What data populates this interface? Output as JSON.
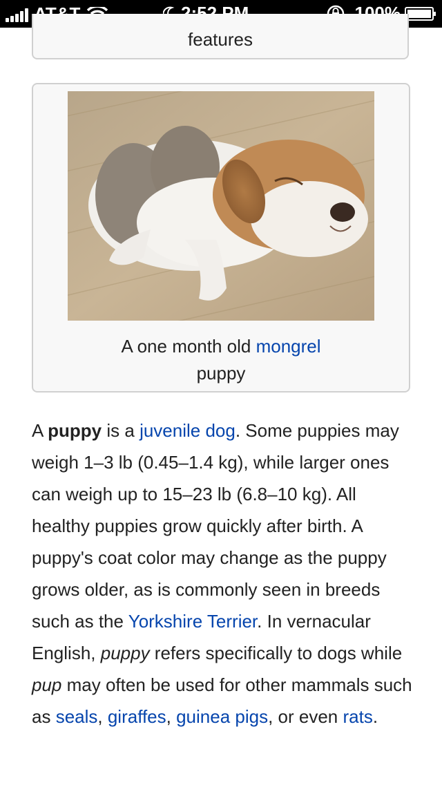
{
  "status_bar": {
    "carrier": "AT&T",
    "time": "2:52 PM",
    "battery": "100%",
    "icons": [
      "signal-icon",
      "wifi-icon",
      "moon-icon",
      "rotation-lock-icon",
      "battery-icon"
    ]
  },
  "top_card": {
    "caption": "features"
  },
  "figure": {
    "caption_prefix": "A one month old ",
    "caption_link": "mongrel",
    "caption_suffix": "puppy"
  },
  "article": {
    "t1": "A ",
    "bold_term": "puppy",
    "t2": " is a ",
    "link_juvenile_dog": "juvenile dog",
    "t3": ". Some puppies may weigh 1–3 lb (0.45–1.4 kg), while larger ones can weigh up to 15–23 lb (6.8–10 kg). All healthy puppies grow quickly after birth. A puppy's coat color may change as the puppy grows older, as is commonly seen in breeds such as the ",
    "link_yorkshire": "Yorkshire Terrier",
    "t4": ". In vernacular English, ",
    "italic_puppy": "puppy",
    "t5": " refers specifically to dogs while ",
    "italic_pup": "pup",
    "t6": " may often be used for other mammals such as ",
    "link_seals": "seals",
    "t7": ", ",
    "link_giraffes": "giraffes",
    "t8": ", ",
    "link_guinea_pigs": "guinea pigs",
    "t9": ", or even ",
    "link_rats": "rats",
    "t10": "."
  },
  "colors": {
    "link": "#0645ad",
    "text": "#222222",
    "card_bg": "#f8f8f8",
    "card_border": "#d0d0d0"
  }
}
